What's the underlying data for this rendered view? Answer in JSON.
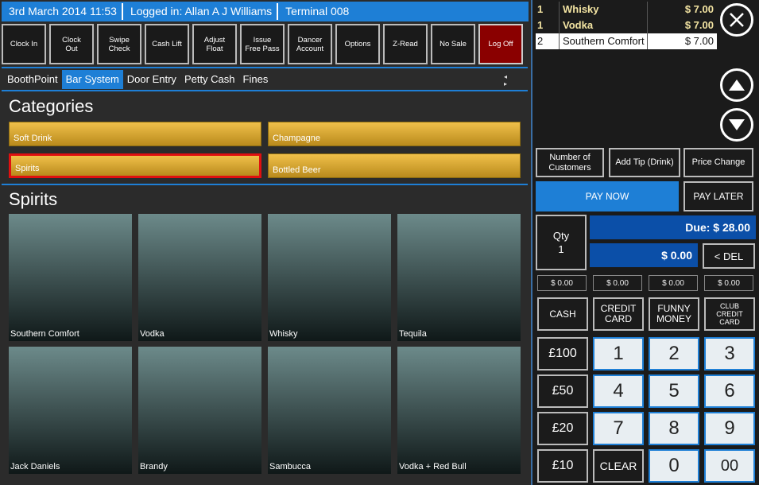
{
  "status": {
    "datetime": "3rd March 2014 11:53",
    "logged_in": "Logged in: Allan A J Williams",
    "terminal": "Terminal 008"
  },
  "toolbar": [
    {
      "label": "Clock In"
    },
    {
      "label": "Clock\nOut"
    },
    {
      "label": "Swipe\nCheck"
    },
    {
      "label": "Cash Lift"
    },
    {
      "label": "Adjust\nFloat"
    },
    {
      "label": "Issue\nFree Pass"
    },
    {
      "label": "Dancer\nAccount"
    },
    {
      "label": "Options"
    },
    {
      "label": "Z-Read"
    },
    {
      "label": "No Sale"
    },
    {
      "label": "Log Off"
    }
  ],
  "tabs": [
    "BoothPoint",
    "Bar System",
    "Door Entry",
    "Petty Cash",
    "Fines"
  ],
  "tab_arrows": "◂ ▸",
  "categories_title": "Categories",
  "categories": [
    "Soft Drink",
    "Champagne",
    "Spirits",
    "Bottled Beer"
  ],
  "split_handle": "·····",
  "products_title": "Spirits",
  "products": [
    "Southern Comfort",
    "Vodka",
    "Whisky",
    "Tequila",
    "Jack Daniels",
    "Brandy",
    "Sambucca",
    "Vodka + Red Bull"
  ],
  "order": [
    {
      "qty": "1",
      "name": "Whisky",
      "price": "$ 7.00"
    },
    {
      "qty": "1",
      "name": "Vodka",
      "price": "$ 7.00"
    },
    {
      "qty": "2",
      "name": "Southern Comfort",
      "price": "$ 7.00"
    }
  ],
  "actions": {
    "num_customers": "Number of\nCustomers",
    "add_tip": "Add Tip (Drink)",
    "price_change": "Price Change",
    "pay_now": "PAY NOW",
    "pay_later": "PAY LATER"
  },
  "qty": {
    "label": "Qty",
    "value": "1"
  },
  "due": "Due: $ 28.00",
  "entry": "$ 0.00",
  "del": "< DEL",
  "tender_amounts": [
    "$ 0.00",
    "$ 0.00",
    "$ 0.00",
    "$ 0.00"
  ],
  "tenders": [
    "CASH",
    "CREDIT\nCARD",
    "FUNNY\nMONEY",
    "CLUB\nCREDIT\nCARD"
  ],
  "quick_cash": [
    "£100",
    "£50",
    "£20",
    "£10"
  ],
  "keypad": [
    "1",
    "2",
    "3",
    "4",
    "5",
    "6",
    "7",
    "8",
    "9"
  ],
  "clear": "CLEAR",
  "zero": "0",
  "double_zero": "00",
  "colors": {
    "accent": "#1e7fd6",
    "logoff": "#8a0000",
    "category": "#d9a430",
    "due": "#0b4fa8"
  }
}
